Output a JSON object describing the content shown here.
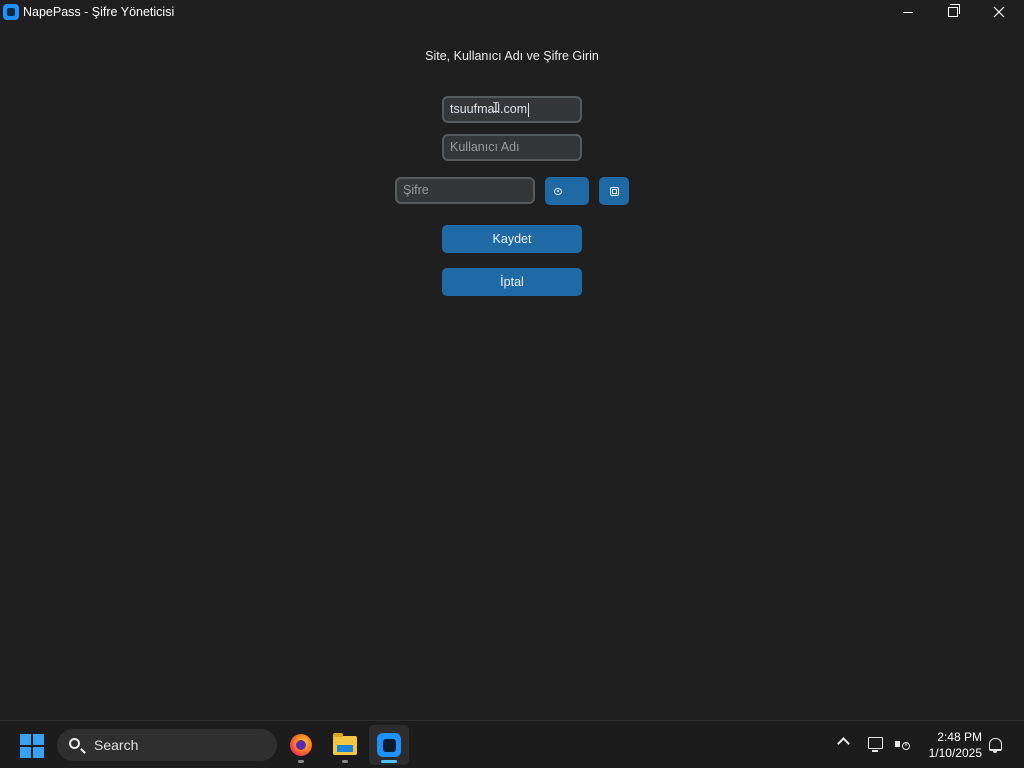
{
  "window": {
    "title": "NapePass - Şifre Yöneticisi"
  },
  "form": {
    "heading": "Site, Kullanıcı Adı ve Şifre Girin",
    "site_value": "tsuufmail.com",
    "username_placeholder": "Kullanıcı Adı",
    "password_placeholder": "Şifre",
    "show_password_icon": "eye-icon",
    "copy_password_icon": "copy-icon",
    "save_label": "Kaydet",
    "cancel_label": "İptal"
  },
  "taskbar": {
    "search_label": "Search",
    "apps": [
      "firefox",
      "file-explorer",
      "napepass"
    ],
    "active_app": "napepass",
    "time": "2:48 PM",
    "date": "1/10/2025"
  },
  "colors": {
    "background": "#1f1f1f",
    "accent_button": "#1f6aa5",
    "field_background": "#343638",
    "field_border": "#565b5e",
    "app_icon": "#1e90ff"
  }
}
